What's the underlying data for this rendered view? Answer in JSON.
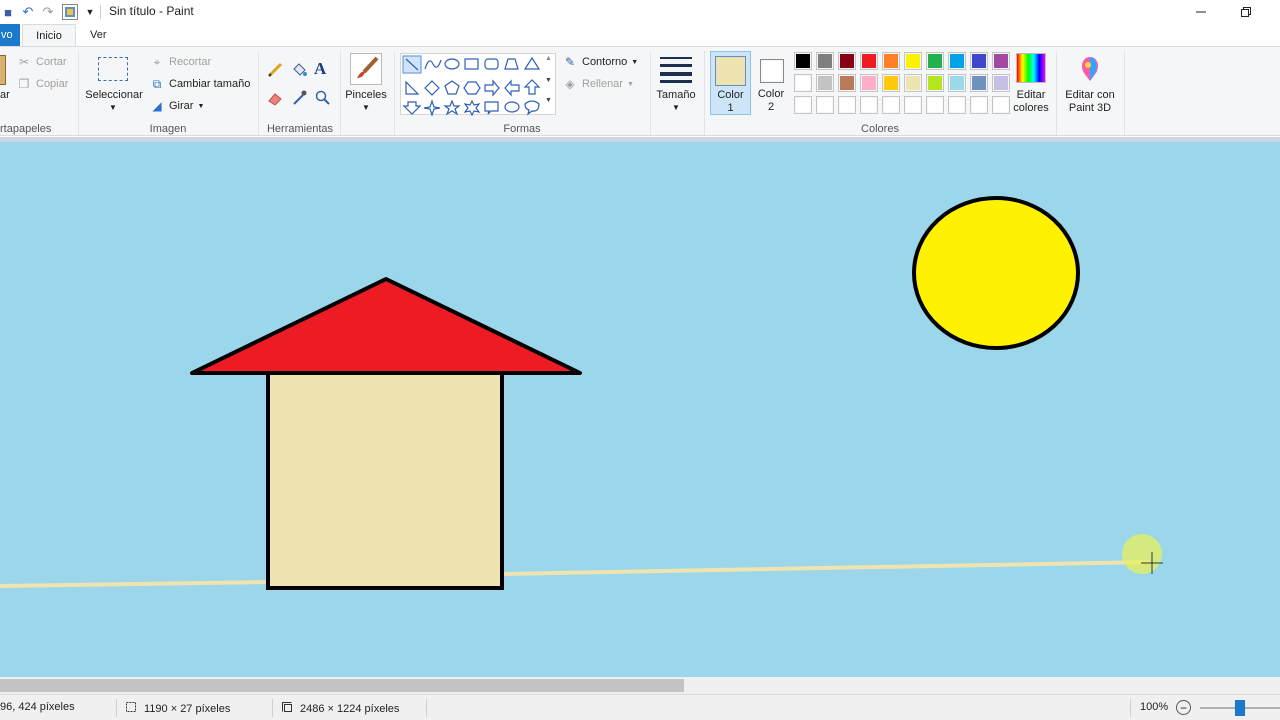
{
  "titlebar": {
    "title": "Sin título - Paint",
    "quick_access": [
      "save-icon",
      "undo-icon",
      "redo-icon",
      "customize-icon",
      "dropdown-icon"
    ],
    "window_controls": [
      "minimize-icon",
      "restore-icon"
    ]
  },
  "tabs": {
    "file": "vo",
    "home": "Inicio",
    "view": "Ver"
  },
  "ribbon": {
    "clipboard": {
      "label": "rtapapeles",
      "paste": "ar",
      "cut": "Cortar",
      "copy": "Copiar"
    },
    "image": {
      "label": "Imagen",
      "select": "Seleccionar",
      "crop": "Recortar",
      "resize": "Cambiar tamaño",
      "rotate": "Girar"
    },
    "tools": {
      "label": "Herramientas"
    },
    "brushes": {
      "label": "Pinceles"
    },
    "shapes": {
      "label": "Formas",
      "outline": "Contorno",
      "fill": "Rellenar"
    },
    "size": {
      "label": "Tamaño"
    },
    "colors": {
      "label": "Colores",
      "color1_line1": "Color",
      "color1_line2": "1",
      "color2_line1": "Color",
      "color2_line2": "2",
      "color1": "#efe4b0",
      "color2": "#ffffff",
      "edit_colors_line1": "Editar",
      "edit_colors_line2": "colores",
      "paint3d_line1": "Editar con",
      "paint3d_line2": "Paint 3D",
      "palette_row1": [
        "#000000",
        "#7f7f7f",
        "#880015",
        "#ed1c24",
        "#ff7f27",
        "#fff200",
        "#22b14c",
        "#00a2e8",
        "#3f48cc",
        "#a349a4"
      ],
      "palette_row2": [
        "#ffffff",
        "#c3c3c3",
        "#b97a57",
        "#ffaec9",
        "#ffc90e",
        "#efe4b0",
        "#b5e61d",
        "#99d9ea",
        "#7092be",
        "#c8bfe7"
      ],
      "palette_row3": [
        "#ffffff",
        "#ffffff",
        "#ffffff",
        "#ffffff",
        "#ffffff",
        "#ffffff",
        "#ffffff",
        "#ffffff",
        "#ffffff",
        "#ffffff"
      ]
    }
  },
  "canvas": {
    "background": "#9cd6ea",
    "roof_color": "#ed1c24",
    "wall_color": "#efe4b0",
    "sun_color": "#fff200",
    "line_color": "#efe4b0"
  },
  "status": {
    "cursor_pos": "96, 424 píxeles",
    "selection_size": "1190 × 27 píxeles",
    "image_size": "2486 × 1224 píxeles",
    "zoom": "100%",
    "zoom_level": 0.5
  }
}
